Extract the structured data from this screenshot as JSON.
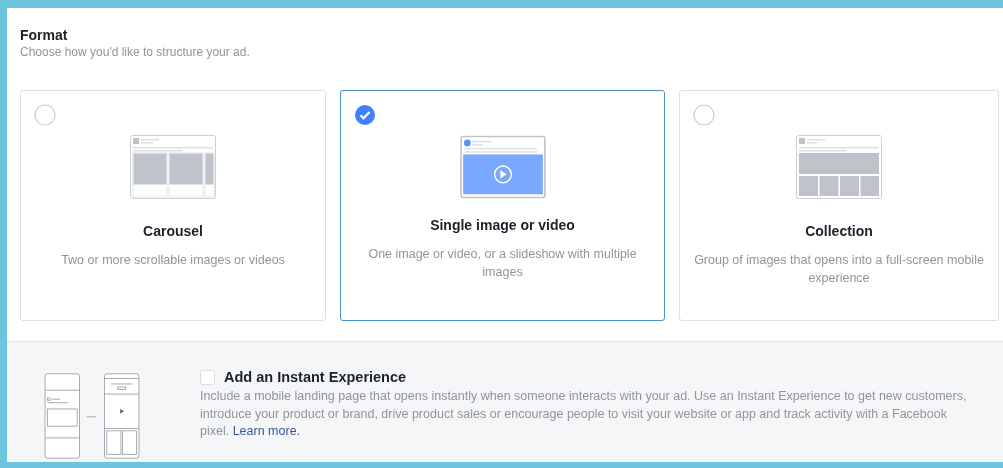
{
  "section": {
    "title": "Format",
    "subtitle": "Choose how you'd like to structure your ad."
  },
  "options": [
    {
      "kind": "carousel",
      "title": "Carousel",
      "description": "Two or more scrollable images or videos",
      "selected": false
    },
    {
      "kind": "single",
      "title": "Single image or video",
      "description": "One image or video, or a slideshow with multiple images",
      "selected": true
    },
    {
      "kind": "collection",
      "title": "Collection",
      "description": "Group of images that opens into a full-screen mobile experience",
      "selected": false
    }
  ],
  "instant_experience": {
    "title": "Add an Instant Experience",
    "checked": false,
    "description": "Include a mobile landing page that opens instantly when someone interacts with your ad. Use an Instant Experience to get new customers, introduce your product or brand, drive product sales or encourage people to visit your website or app and track activity with a Facebook pixel.",
    "link": "Learn more."
  }
}
